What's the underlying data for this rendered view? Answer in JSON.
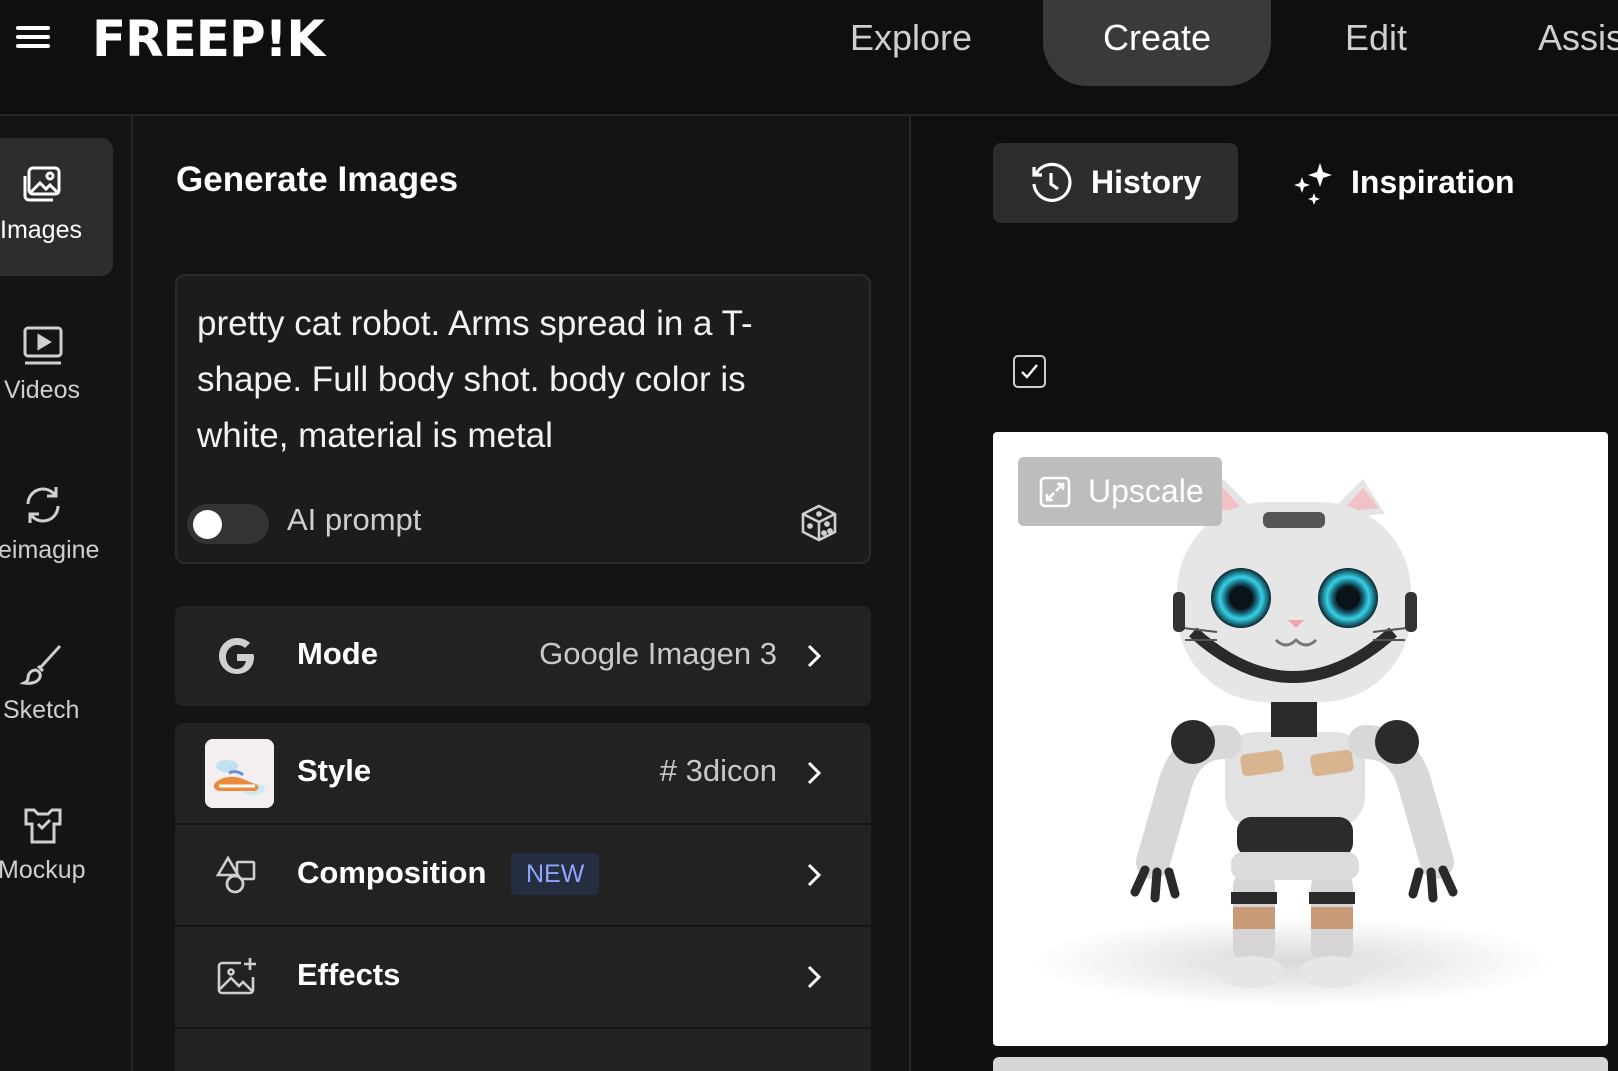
{
  "header": {
    "logo": "FREEP!K",
    "nav": [
      {
        "label": "Explore"
      },
      {
        "label": "Create",
        "active": true
      },
      {
        "label": "Edit"
      },
      {
        "label": "Assis"
      }
    ]
  },
  "sidebar": {
    "items": [
      {
        "label": "Images",
        "icon": "images-icon",
        "active": true
      },
      {
        "label": "Videos",
        "icon": "video-icon"
      },
      {
        "label": "eimagine",
        "icon": "reimagine-icon"
      },
      {
        "label": "Sketch",
        "icon": "brush-icon"
      },
      {
        "label": "Mockup",
        "icon": "mockup-icon"
      }
    ]
  },
  "panel": {
    "title": "Generate Images",
    "prompt": {
      "text": "pretty cat robot. Arms spread in a T-shape. Full body shot. body color is white, material is metal",
      "ai_prompt_label": "AI prompt",
      "ai_prompt_enabled": false
    },
    "settings": {
      "mode": {
        "label": "Mode",
        "value": "Google Imagen 3"
      },
      "style": {
        "label": "Style",
        "value": "# 3dicon"
      },
      "composition": {
        "label": "Composition",
        "badge": "NEW"
      },
      "effects": {
        "label": "Effects"
      }
    }
  },
  "results": {
    "tabs": [
      {
        "label": "History",
        "icon": "history-icon",
        "active": true
      },
      {
        "label": "Inspiration",
        "icon": "sparkle-icon"
      }
    ],
    "select_checked": true,
    "upscale_label": "Upscale"
  },
  "colors": {
    "background": "#0f0f0f",
    "panel": "#141414",
    "row": "#222222",
    "active_tab": "#2d2d2d",
    "badge_text": "#8ea6ff",
    "badge_bg": "#252d40"
  }
}
